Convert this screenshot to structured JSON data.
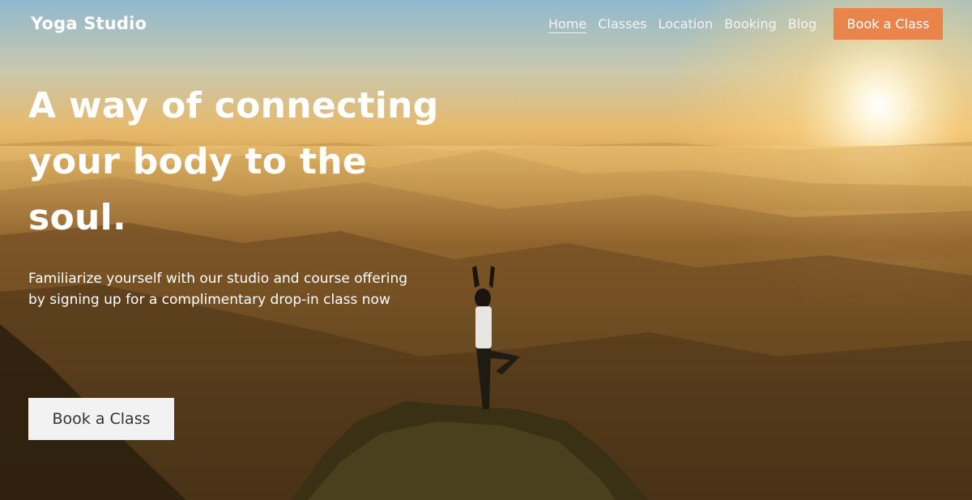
{
  "brand": {
    "name": "Yoga Studio"
  },
  "nav": {
    "items": [
      {
        "label": "Home",
        "active": true
      },
      {
        "label": "Classes"
      },
      {
        "label": "Location"
      },
      {
        "label": "Booking"
      },
      {
        "label": "Blog"
      }
    ],
    "cta_label": "Book a Class"
  },
  "hero": {
    "headline": "A way of connecting your body to the soul.",
    "subtext": "Familiarize yourself with our studio and course offering by signing up for a complimentary drop-in class now",
    "cta_label": "Book a Class",
    "background": "mountain-sunrise-yoga-photo"
  },
  "colors": {
    "accent": "#e9844a",
    "text": "#ffffff",
    "button_light": "#f2f2f2"
  }
}
